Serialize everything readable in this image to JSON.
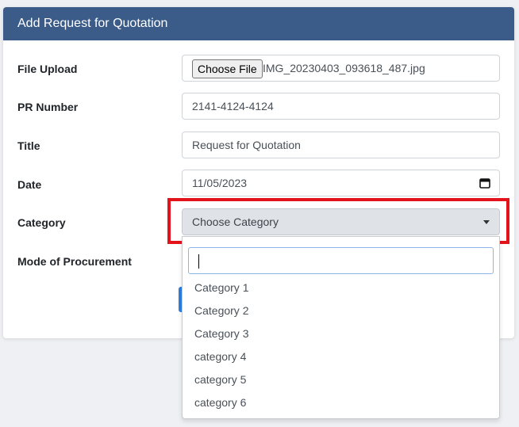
{
  "header": {
    "title": "Add Request for Quotation"
  },
  "form": {
    "file_upload": {
      "label": "File Upload",
      "button": "Choose File",
      "file_name": "IMG_20230403_093618_487.jpg"
    },
    "pr_number": {
      "label": "PR Number",
      "value": "2141-4124-4124"
    },
    "title": {
      "label": "Title",
      "value": "Request for Quotation"
    },
    "date": {
      "label": "Date",
      "value": "11/05/2023"
    },
    "category": {
      "label": "Category",
      "selected": "Choose Category"
    },
    "mode_of_procurement": {
      "label": "Mode of Procurement"
    }
  },
  "dropdown": {
    "search_value": "",
    "options": [
      "Category 1",
      "Category 2",
      "Category 3",
      "category 4",
      "category 5",
      "category 6"
    ]
  },
  "colors": {
    "header_bg": "#3b5b88",
    "highlight": "#e3131b",
    "focus": "#8fb4ea"
  }
}
